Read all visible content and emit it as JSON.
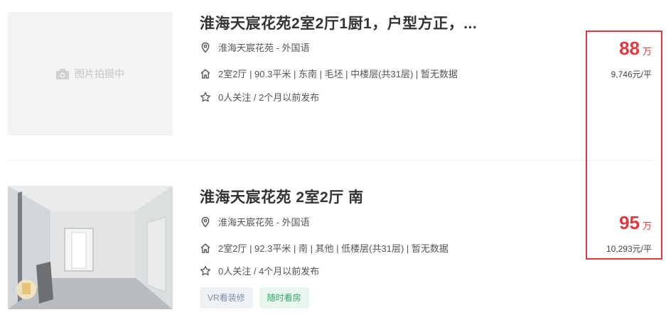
{
  "colors": {
    "price": "#e4393c",
    "highlight": "#e4393c",
    "tag_anytime": "#2fa868"
  },
  "listings": [
    {
      "title": "淮海天宸花苑2室2厅1厨1，户型方正，...",
      "image_placeholder": "图片拍摄中",
      "location": "淮海天宸花苑 - 外国语",
      "info": "2室2厅 | 90.3平米 | 东南 | 毛坯 | 中楼层(共31层) | 暂无数据",
      "follow": "0人关注 / 2个月以前发布",
      "total_price": "88",
      "total_unit": "万",
      "unit_price": "9,746元/平"
    },
    {
      "title": "淮海天宸花苑 2室2厅 南",
      "location": "淮海天宸花苑 - 外国语",
      "info": "2室2厅 | 92.3平米 | 南 | 其他 | 低楼层(共31层) | 暂无数据",
      "follow": "0人关注 / 4个月以前发布",
      "tags": [
        "VR看装修",
        "随时看房"
      ],
      "total_price": "95",
      "total_unit": "万",
      "unit_price": "10,293元/平"
    }
  ]
}
